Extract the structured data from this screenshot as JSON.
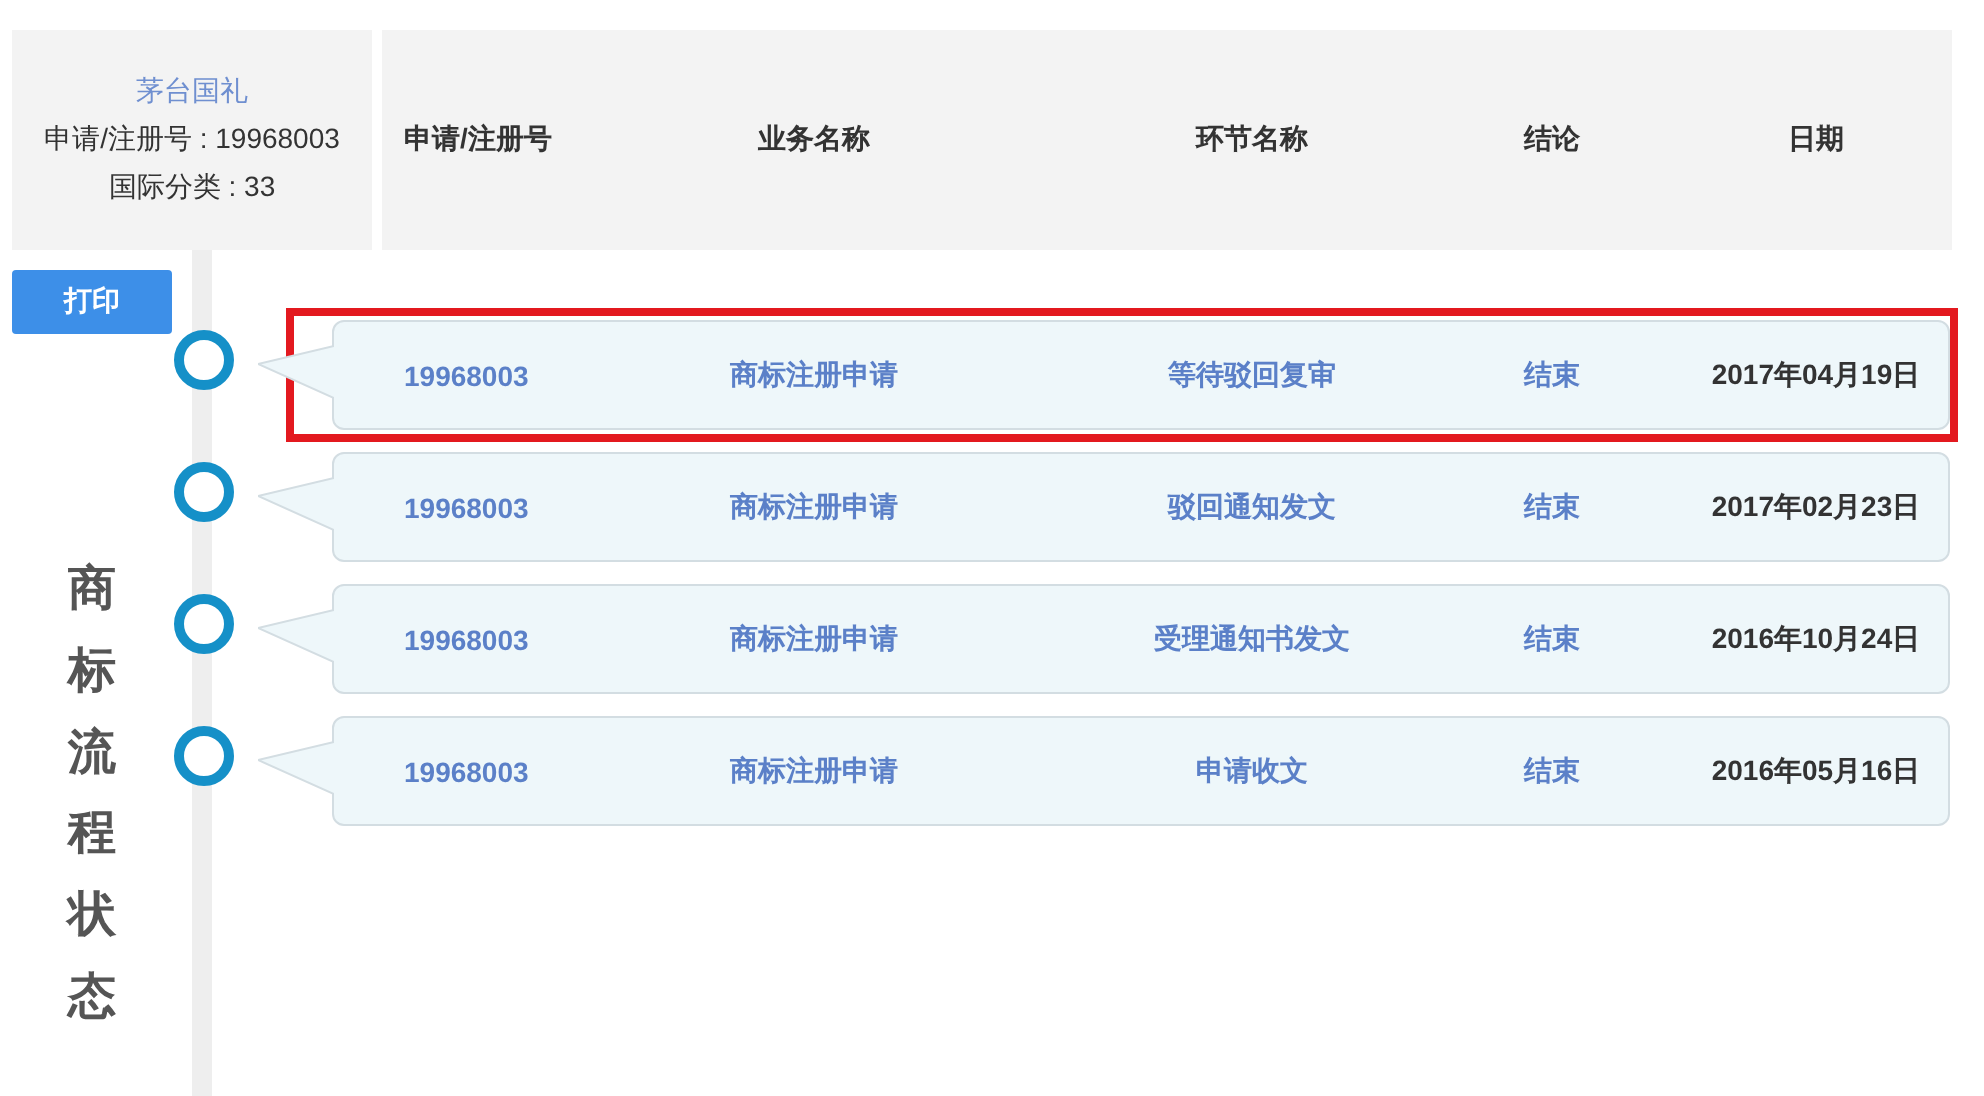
{
  "mark": {
    "name": "茅台国礼",
    "registration": "申请/注册号 : 19968003",
    "class": "国际分类 : 33"
  },
  "columns": [
    "申请/注册号",
    "业务名称",
    "环节名称",
    "结论",
    "日期"
  ],
  "print_button": "打印",
  "side_title": "商标流程状态",
  "rows": [
    {
      "number": "19968003",
      "business": "商标注册申请",
      "step": "等待驳回复审",
      "result": "结束",
      "date": "2017年04月19日",
      "selected": true
    },
    {
      "number": "19968003",
      "business": "商标注册申请",
      "step": "驳回通知发文",
      "result": "结束",
      "date": "2017年02月23日",
      "selected": false
    },
    {
      "number": "19968003",
      "business": "商标注册申请",
      "step": "受理通知书发文",
      "result": "结束",
      "date": "2016年10月24日",
      "selected": false
    },
    {
      "number": "19968003",
      "business": "商标注册申请",
      "step": "申请收文",
      "result": "结束",
      "date": "2016年05月16日",
      "selected": false
    }
  ]
}
